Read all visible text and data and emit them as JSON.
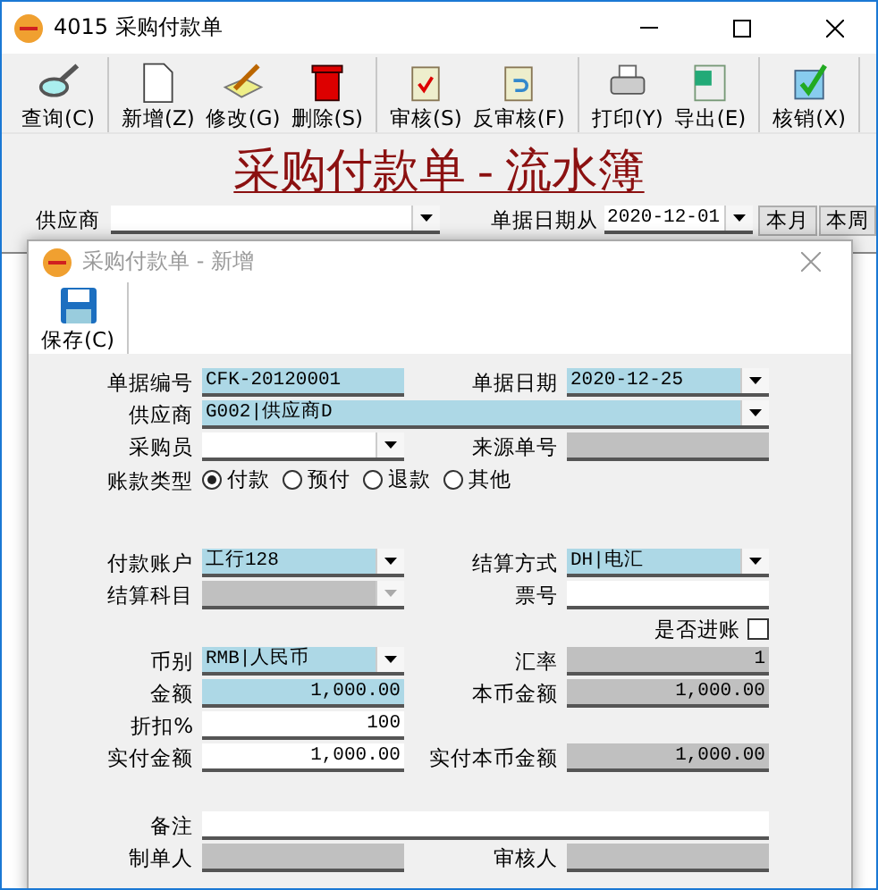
{
  "window": {
    "title": "4015 采购付款单"
  },
  "toolbar": [
    [
      {
        "label": "查询(C)"
      }
    ],
    [
      {
        "label": "新增(Z)"
      },
      {
        "label": "修改(G)"
      },
      {
        "label": "删除(S)"
      }
    ],
    [
      {
        "label": "审核(S)"
      },
      {
        "label": "反审核(F)"
      }
    ],
    [
      {
        "label": "打印(Y)"
      },
      {
        "label": "导出(E)"
      }
    ],
    [
      {
        "label": "核销(X)"
      }
    ]
  ],
  "heading": "采购付款单 - 流水簿",
  "filter": {
    "supplier_label": "供应商",
    "date_label": "单据日期从",
    "date_value": "2020-12-01",
    "buttons": [
      "本月",
      "本周"
    ]
  },
  "dialog": {
    "title": "采购付款单 - 新增",
    "toolbar": [
      {
        "label": "保存(C)"
      }
    ],
    "sections": [
      {
        "rows": [
          {
            "kind": "fields",
            "fields": [
              {
                "label": "单据编号",
                "value": "CFK-20120001",
                "kind": "text",
                "required": true
              },
              {
                "label": "单据日期",
                "value": "2020-12-25",
                "kind": "combo",
                "required": true
              }
            ]
          },
          {
            "kind": "fields",
            "fields": [
              {
                "label": "供应商",
                "value": "G002|供应商D",
                "kind": "combo",
                "required": true,
                "wide": true
              }
            ]
          },
          {
            "kind": "fields",
            "fields": [
              {
                "label": "采购员",
                "kind": "combo"
              },
              {
                "label": "来源单号",
                "kind": "text",
                "disabled": true
              }
            ]
          },
          {
            "kind": "radio",
            "label": "账款类型",
            "options": [
              {
                "label": "付款",
                "selected": true
              },
              {
                "label": "预付",
                "selected": false
              },
              {
                "label": "退款",
                "selected": false
              },
              {
                "label": "其他",
                "selected": false
              }
            ]
          }
        ]
      },
      {
        "rows": [
          {
            "kind": "fields",
            "fields": [
              {
                "label": "付款账户",
                "value": "工行128",
                "kind": "combo",
                "required": true
              },
              {
                "label": "结算方式",
                "value": "DH|电汇",
                "kind": "combo",
                "required": true
              }
            ]
          },
          {
            "kind": "fields",
            "fields": [
              {
                "label": "结算科目",
                "kind": "combo",
                "disabled": true
              },
              {
                "label": "票号",
                "kind": "text"
              }
            ]
          },
          {
            "kind": "checkbox",
            "label": "是否进账",
            "checked": false
          },
          {
            "kind": "fields",
            "fields": [
              {
                "label": "币别",
                "value": "RMB|人民币",
                "kind": "combo",
                "required": true
              },
              {
                "label": "汇率",
                "value": "1",
                "kind": "text",
                "disabled": true,
                "numeric": true
              }
            ]
          },
          {
            "kind": "fields",
            "fields": [
              {
                "label": "金额",
                "value": "1,000.00",
                "kind": "text",
                "required": true,
                "numeric": true
              },
              {
                "label": "本币金额",
                "value": "1,000.00",
                "kind": "text",
                "disabled": true,
                "numeric": true
              }
            ]
          },
          {
            "kind": "fields",
            "fields": [
              {
                "label": "折扣%",
                "value": "100",
                "kind": "text",
                "numeric": true
              }
            ]
          },
          {
            "kind": "fields",
            "fields": [
              {
                "label": "实付金额",
                "value": "1,000.00",
                "kind": "text",
                "numeric": true
              },
              {
                "label": "实付本币金额",
                "value": "1,000.00",
                "kind": "text",
                "disabled": true,
                "numeric": true
              }
            ]
          }
        ]
      },
      {
        "rows": [
          {
            "kind": "fields",
            "fields": [
              {
                "label": "备注",
                "kind": "text",
                "wide": true
              }
            ]
          },
          {
            "kind": "fields",
            "fields": [
              {
                "label": "制单人",
                "kind": "text",
                "disabled": true
              },
              {
                "label": "审核人",
                "kind": "text",
                "disabled": true
              }
            ]
          }
        ]
      }
    ]
  }
}
